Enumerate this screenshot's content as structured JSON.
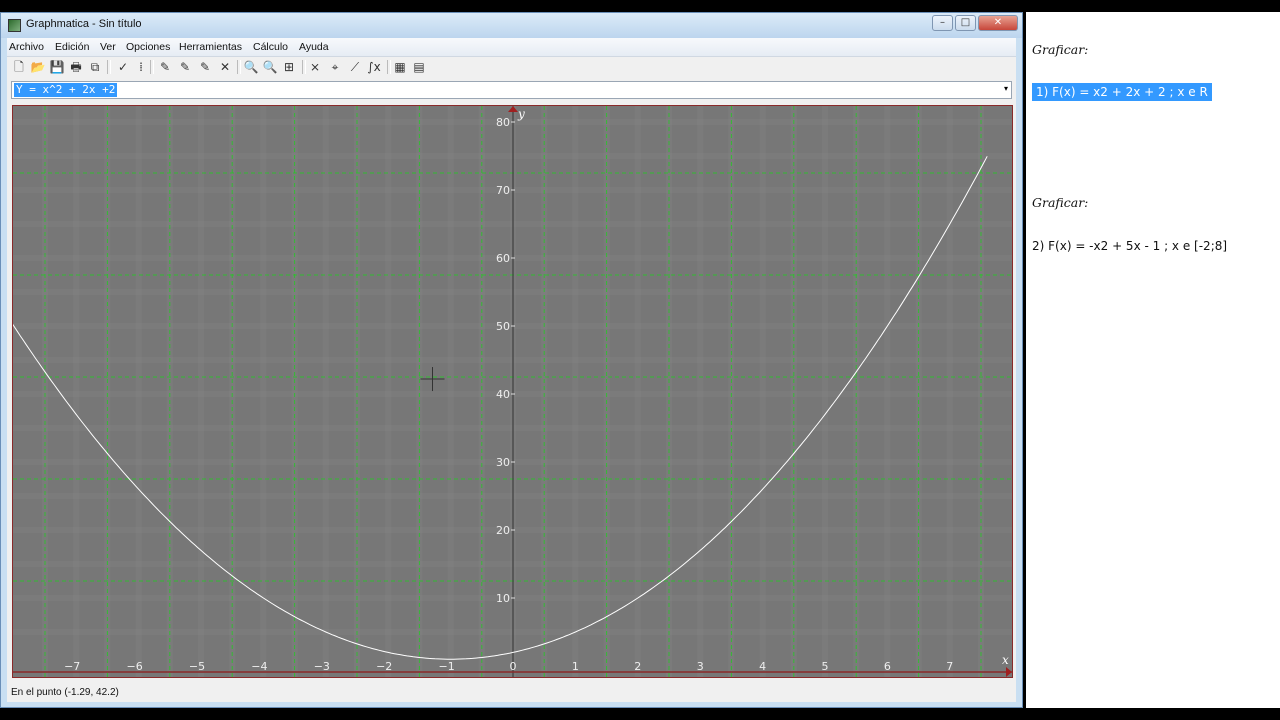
{
  "window": {
    "title": "Graphmatica - Sin título",
    "controls": {
      "minimize": "–",
      "maximize": "□",
      "close": "✕"
    }
  },
  "menu": [
    "Archivo",
    "Edición",
    "Ver",
    "Opciones",
    "Herramientas",
    "Cálculo",
    "Ayuda"
  ],
  "toolbar": [
    {
      "name": "new-icon",
      "glyph": "🗋"
    },
    {
      "name": "open-icon",
      "glyph": "📂"
    },
    {
      "name": "save-icon",
      "glyph": "💾"
    },
    {
      "name": "print-icon",
      "glyph": "🖶"
    },
    {
      "name": "copy-icon",
      "glyph": "⧉"
    },
    {
      "name": "graph-icon",
      "glyph": "✓"
    },
    {
      "name": "grid-icon",
      "glyph": "⁞"
    },
    {
      "name": "pen-add-icon",
      "glyph": "✎"
    },
    {
      "name": "pen-edit-icon",
      "glyph": "✎"
    },
    {
      "name": "pen-redraw-icon",
      "glyph": "✎"
    },
    {
      "name": "delete-icon",
      "glyph": "✕"
    },
    {
      "name": "zoom-in-icon",
      "glyph": "🔍"
    },
    {
      "name": "zoom-out-icon",
      "glyph": "🔍"
    },
    {
      "name": "zoom-fit-icon",
      "glyph": "⊞"
    },
    {
      "name": "intersect-icon",
      "glyph": "⨯"
    },
    {
      "name": "trace-icon",
      "glyph": "⌖"
    },
    {
      "name": "tangent-icon",
      "glyph": "⟋"
    },
    {
      "name": "integral-icon",
      "glyph": "∫x"
    },
    {
      "name": "table-icon",
      "glyph": "▦"
    },
    {
      "name": "legend-icon",
      "glyph": "▤"
    }
  ],
  "equation": {
    "value": "Y = x^2 + 2x +2",
    "dropdown_icon": "▾"
  },
  "graph": {
    "background": "#777777",
    "grid_color": "#22cc22",
    "curve_color": "#ffffff",
    "axis_label_x": "x",
    "axis_label_y": "y",
    "x_ticks": [
      "−7",
      "−6",
      "−5",
      "−4",
      "−3",
      "−2",
      "−1",
      "0",
      "1",
      "2",
      "3",
      "4",
      "5",
      "6",
      "7"
    ],
    "y_ticks": [
      "10",
      "20",
      "30",
      "40",
      "50",
      "60",
      "70",
      "80"
    ],
    "x_range": [
      -8,
      8
    ],
    "y_range": [
      -1,
      82
    ],
    "cursor": [
      -1.29,
      42.2
    ]
  },
  "status": "En el punto (-1.29, 42.2)",
  "notes": {
    "graficar_1": "Graficar:",
    "eq_1": "1) F(x) = x2 + 2x + 2 ; x e R",
    "graficar_2": "Graficar:",
    "eq_2": "2) F(x) = -x2 + 5x - 1 ; x e [-2;8]"
  }
}
